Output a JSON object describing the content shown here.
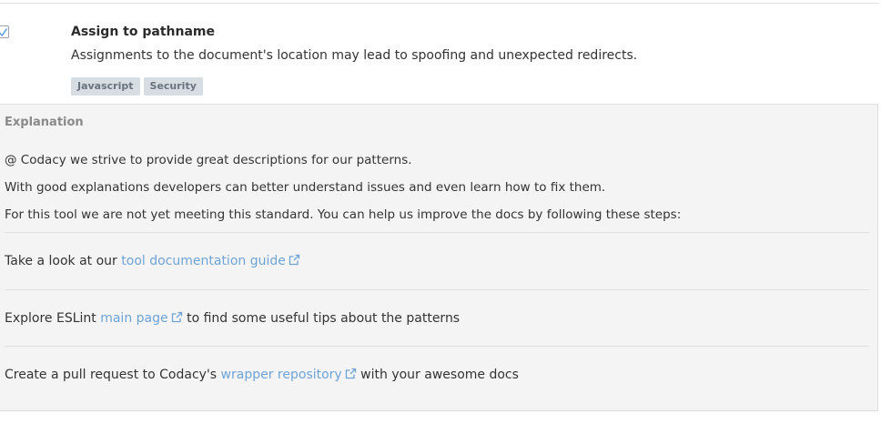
{
  "pattern": {
    "title": "Assign to pathname",
    "description": "Assignments to the document's location may lead to spoofing and unexpected redirects.",
    "tags": [
      "Javascript",
      "Security"
    ],
    "checked": true
  },
  "explanation": {
    "heading": "Explanation",
    "lines": [
      "@ Codacy we strive to provide great descriptions for our patterns.",
      "With good explanations developers can better understand issues and even learn how to fix them.",
      "For this tool we are not yet meeting this standard. You can help us improve the docs by following these steps:"
    ],
    "steps": [
      {
        "before": "Take a look at our ",
        "link": "tool documentation guide",
        "after": ""
      },
      {
        "before": "Explore ESLint ",
        "link": "main page",
        "after": " to find some useful tips about the patterns"
      },
      {
        "before": "Create a pull request to Codacy's ",
        "link": "wrapper repository",
        "after": " with your awesome docs"
      }
    ]
  },
  "colors": {
    "link": "#6ea3d8",
    "tag_bg": "#d6dee3",
    "panel_bg": "#f4f4f4"
  },
  "icons": {
    "external": "external-link-icon",
    "check": "checkmark-icon"
  }
}
